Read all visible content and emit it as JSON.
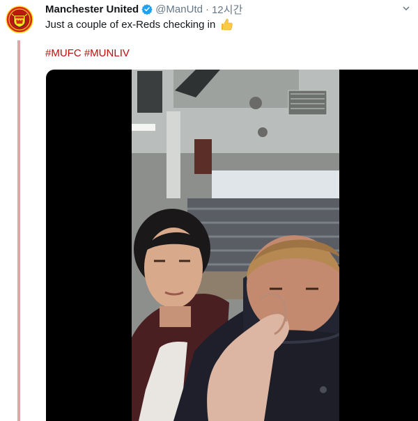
{
  "tweet": {
    "author_name": "Manchester United",
    "handle": "@ManUtd",
    "separator": "·",
    "time": "12시간",
    "text": "Just a couple of ex-Reds checking in",
    "hashtags": [
      "#MUFC",
      "#MUNLIV"
    ],
    "emoji_icon": "thumbs-up-icon",
    "verified_icon": "verified-badge-icon",
    "menu_icon": "chevron-down-icon"
  },
  "colors": {
    "hashtag": "#c20a0a",
    "verified": "#1da1f2",
    "thread_line": "#e0a5a8",
    "brand_red": "#da291c",
    "brand_gold": "#fbe122"
  },
  "media": {
    "type": "video",
    "description_icon": "selfie-video-frame"
  }
}
